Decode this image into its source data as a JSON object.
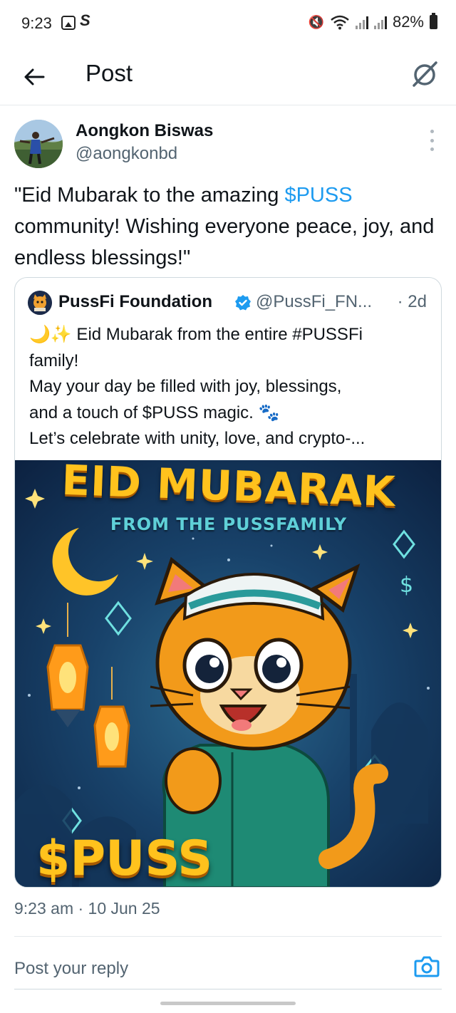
{
  "status_bar": {
    "time": "9:23",
    "battery": "82%"
  },
  "header": {
    "title": "Post"
  },
  "post": {
    "author_name": "Aongkon Biswas",
    "author_handle": "@aongkonbd",
    "text_before": "\"Eid Mubarak to the amazing ",
    "cashtag": "$PUSS",
    "text_after": " community! Wishing everyone peace, joy, and endless blessings!\"",
    "timestamp": "9:23 am · 10 Jun 25"
  },
  "quote": {
    "author_name": "PussFi Foundation",
    "author_handle": "@PussFi_FN...",
    "time": "· 2d",
    "lines": [
      "🌙✨ Eid Mubarak from the entire #PUSSFi",
      "family!",
      "May your day be filled with joy, blessings,",
      "and a touch of $PUSS magic. 🐾",
      "Let’s celebrate with unity, love, and crypto-..."
    ],
    "image": {
      "title": "EID MUBARAK",
      "subtitle": "FROM THE PUSSFAMILY",
      "bottom_text": "$PUSS"
    }
  },
  "reply": {
    "placeholder": "Post your reply"
  },
  "colors": {
    "accent": "#1d9bf0",
    "muted_text": "#536471",
    "border": "#cfd9de"
  }
}
